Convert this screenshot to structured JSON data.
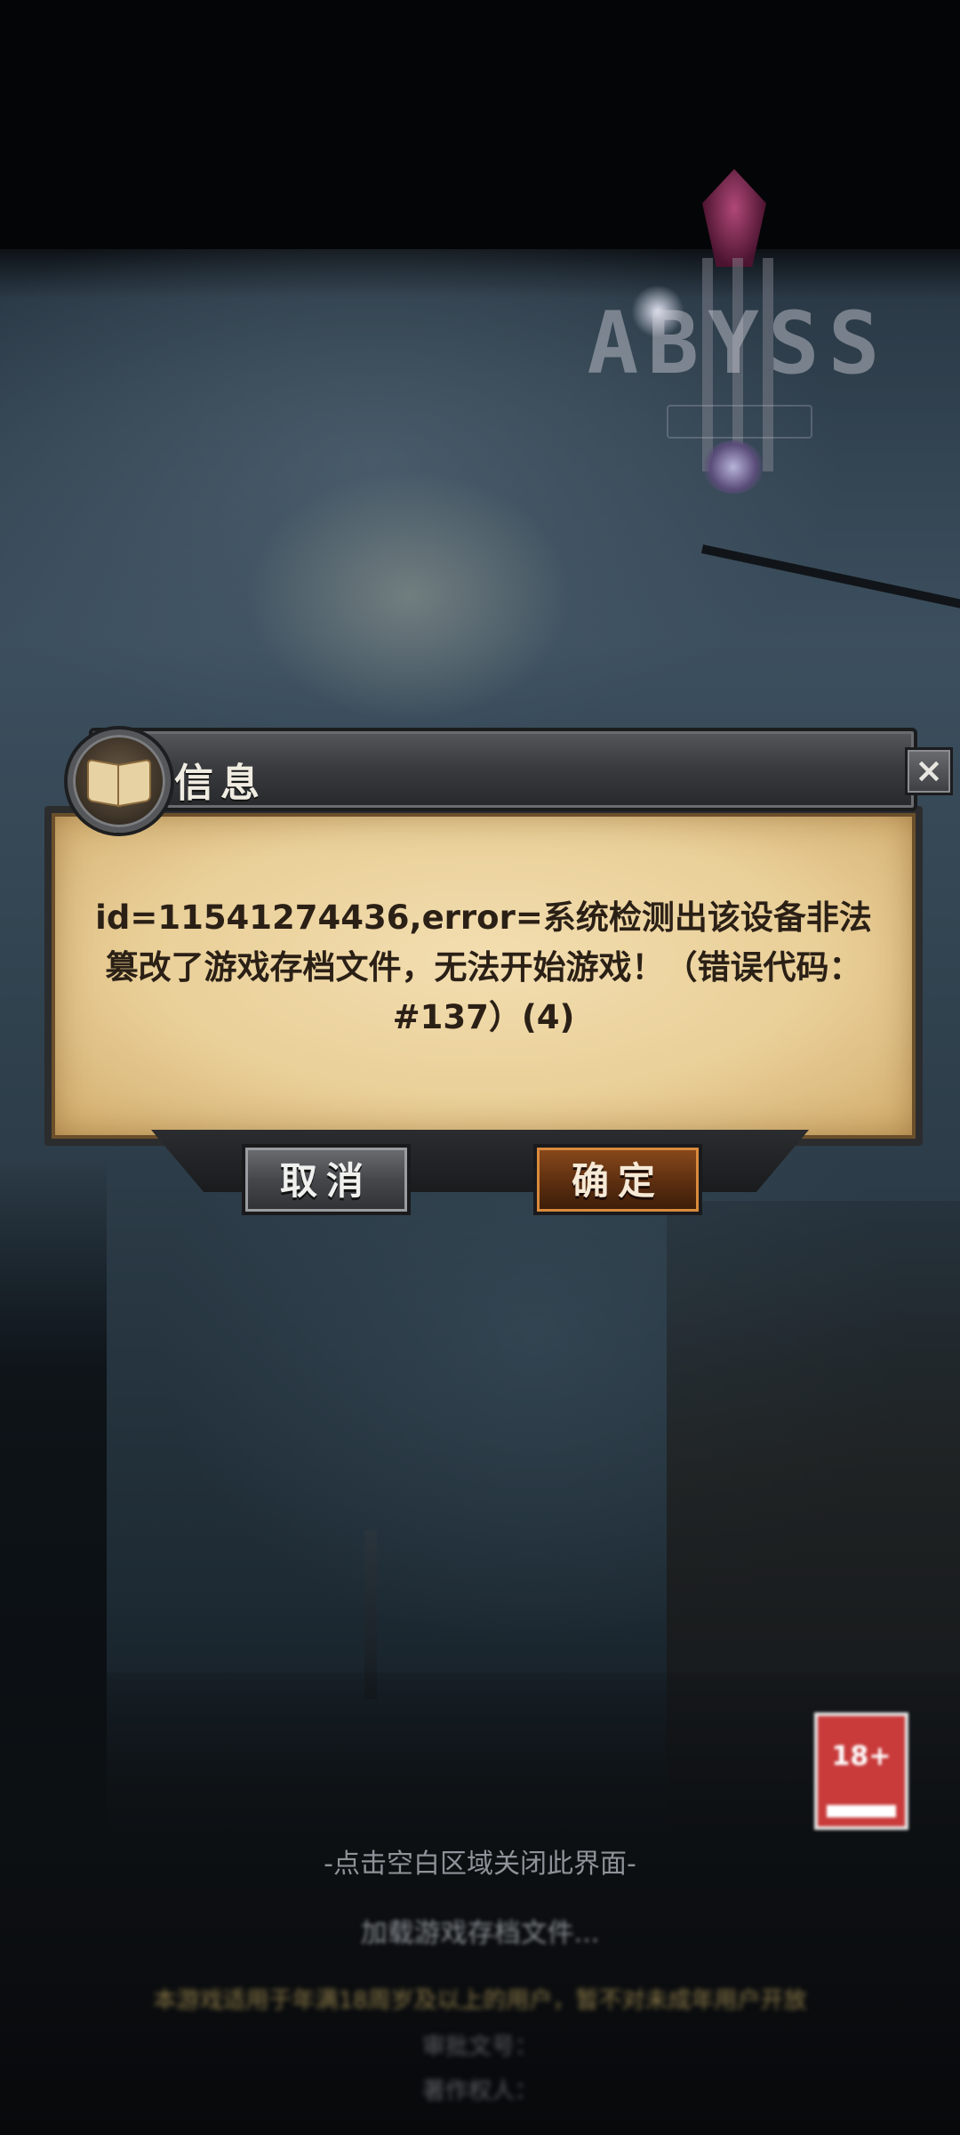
{
  "logo": {
    "text": "ABYSS"
  },
  "dialog": {
    "title": "信息",
    "close_label": "×",
    "message": "id=11541274436,error=系统检测出该设备非法篡改了游戏存档文件，无法开始游戏！（错误代码：#137）(4)",
    "cancel_label": "取消",
    "ok_label": "确定"
  },
  "hint": "-点击空白区域关闭此界面-",
  "loading_text": "加载游戏存档文件...",
  "age_rating": {
    "label": "18+"
  },
  "legal_lines": [
    "本游戏适用于年满18周岁及以上的用户，暂不对未成年用户开放",
    "审批文号：",
    "著作权人："
  ],
  "colors": {
    "parchment": "#e9cf98",
    "confirm_button": "#5c2e10",
    "cancel_button": "#45474b",
    "age_badge": "#c93a3a"
  }
}
